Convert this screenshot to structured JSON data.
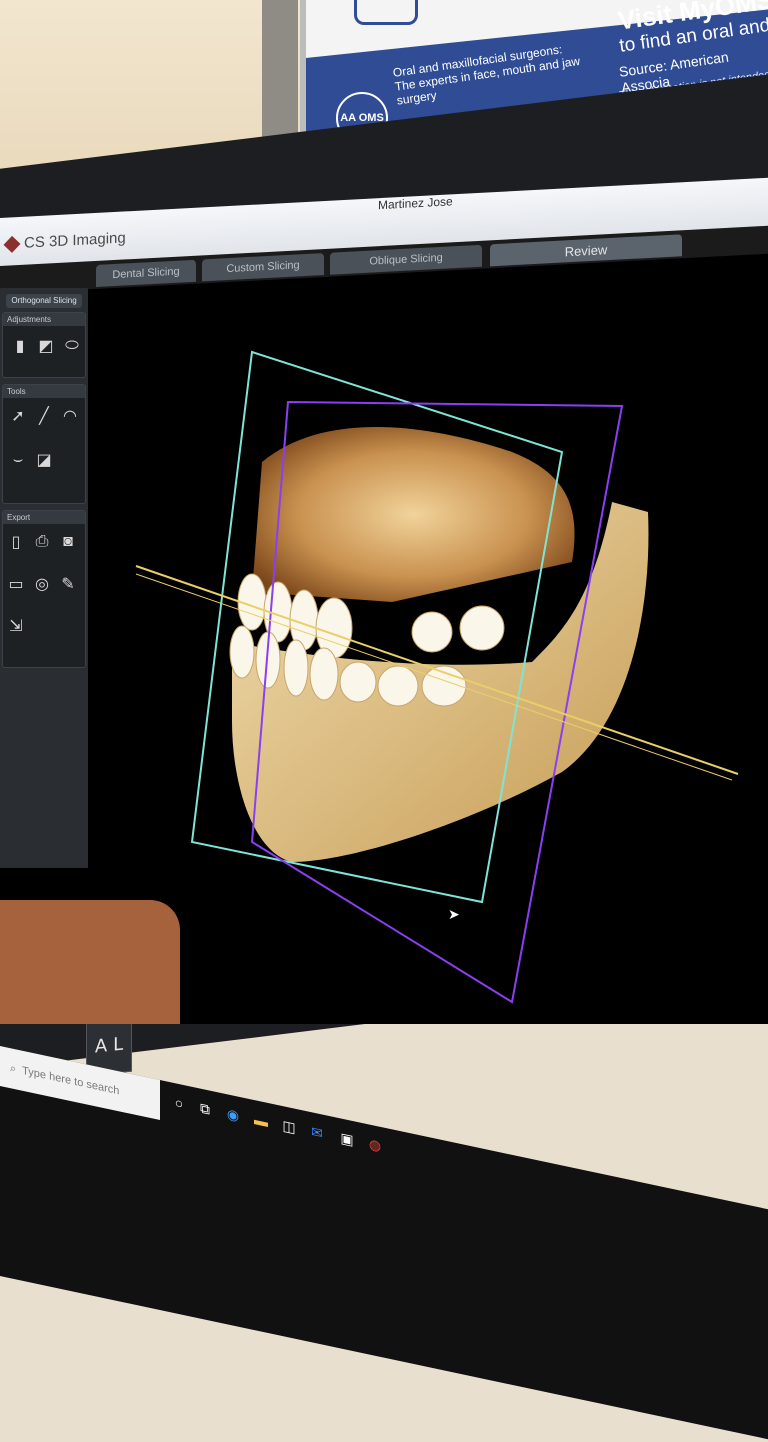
{
  "poster": {
    "headline": "Visit MyOMS",
    "line2": "to find an oral and",
    "source": "Source: American Associa",
    "note": "This information is not intended",
    "description": "Oral and maxillofacial surgeons: The experts in face, mouth and jaw surgery",
    "logo_text": "AA OMS"
  },
  "window": {
    "title": "Martinez Jose",
    "brand": "CS 3D Imaging"
  },
  "tabs": [
    {
      "label": "Dental Slicing"
    },
    {
      "label": "Custom Slicing"
    },
    {
      "label": "Oblique Slicing"
    },
    {
      "label": "Review"
    }
  ],
  "sidebar": {
    "mode_label": "Orthogonal Slicing",
    "panels": {
      "adjustments": "Adjustments",
      "tools": "Tools",
      "export": "Export"
    }
  },
  "viewport": {
    "orientation_labels": [
      "A",
      "L"
    ]
  },
  "taskbar": {
    "search_placeholder": "Type here to search"
  },
  "colors": {
    "cyan_plane": "#7fe3d6",
    "purple_plane": "#8a3ff0",
    "yellow_line": "#e8cf6a",
    "bone": "#e7c98a",
    "poster_blue": "#2f4c95"
  }
}
